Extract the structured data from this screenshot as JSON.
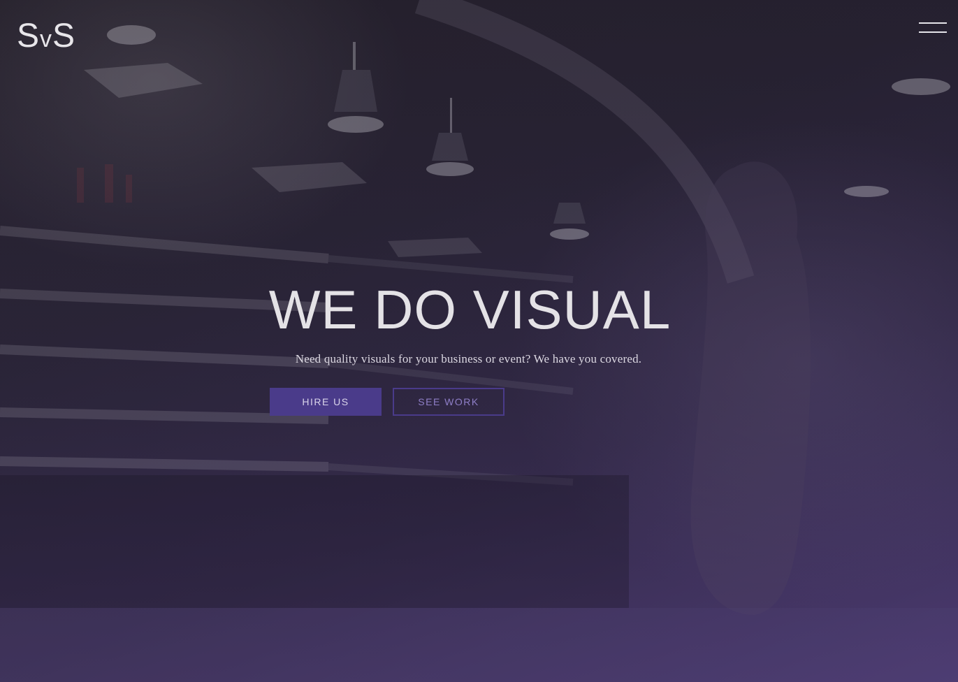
{
  "brand": {
    "logo_big_1": "S",
    "logo_small": "v",
    "logo_big_2": "S"
  },
  "hero": {
    "headline": "WE DO VISUAL",
    "tagline": "Need quality visuals for your business or event? We have you covered."
  },
  "actions": {
    "hire_label": "HIRE US",
    "work_label": "SEE WORK"
  },
  "icons": {
    "menu": "hamburger-menu-icon"
  },
  "colors": {
    "accent": "#4a3b8a",
    "accent_text": "#8f7fc8",
    "text": "#e4e2e6"
  }
}
